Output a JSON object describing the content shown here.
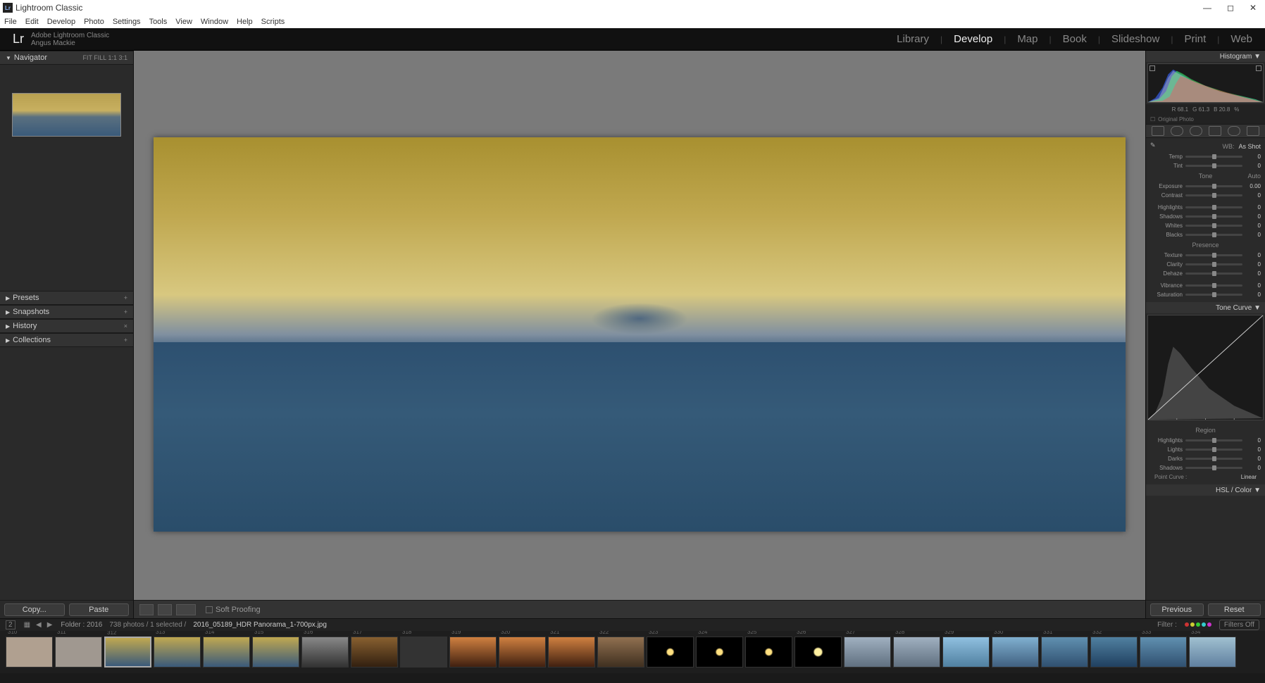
{
  "app_title": "Lightroom Classic",
  "menu": [
    "File",
    "Edit",
    "Develop",
    "Photo",
    "Settings",
    "Tools",
    "View",
    "Window",
    "Help",
    "Scripts"
  ],
  "brand_line1": "Adobe Lightroom Classic",
  "brand_line2": "Angus Mackie",
  "modules": [
    "Library",
    "Develop",
    "Map",
    "Book",
    "Slideshow",
    "Print",
    "Web"
  ],
  "active_module": "Develop",
  "navigator": {
    "label": "Navigator",
    "zoom": "FIT  FILL  1:1  3:1"
  },
  "left_panels": [
    {
      "name": "Presets",
      "extra": "+"
    },
    {
      "name": "Snapshots",
      "extra": "+"
    },
    {
      "name": "History",
      "extra": "×"
    },
    {
      "name": "Collections",
      "extra": "+"
    }
  ],
  "copy_btn": "Copy...",
  "paste_btn": "Paste",
  "soft_proofing": "Soft Proofing",
  "previous_btn": "Previous",
  "reset_btn": "Reset",
  "histogram_label": "Histogram",
  "rgb": {
    "r": "R  68.1",
    "g": "G  61.3",
    "b": "B  20.8",
    "pct": "%"
  },
  "original_photo": "Original Photo",
  "basic": {
    "wb_label": "WB:",
    "wb_value": "As Shot",
    "sliders_top": [
      {
        "label": "Temp",
        "val": "0"
      },
      {
        "label": "Tint",
        "val": "0"
      }
    ],
    "tone_label": "Tone",
    "auto_label": "Auto",
    "sliders_tone": [
      {
        "label": "Exposure",
        "val": "0.00"
      },
      {
        "label": "Contrast",
        "val": "0"
      }
    ],
    "sliders_tone2": [
      {
        "label": "Highlights",
        "val": "0"
      },
      {
        "label": "Shadows",
        "val": "0"
      },
      {
        "label": "Whites",
        "val": "0"
      },
      {
        "label": "Blacks",
        "val": "0"
      }
    ],
    "presence_label": "Presence",
    "sliders_presence": [
      {
        "label": "Texture",
        "val": "0"
      },
      {
        "label": "Clarity",
        "val": "0"
      },
      {
        "label": "Dehaze",
        "val": "0"
      }
    ],
    "sliders_presence2": [
      {
        "label": "Vibrance",
        "val": "0"
      },
      {
        "label": "Saturation",
        "val": "0"
      }
    ]
  },
  "tone_curve_label": "Tone Curve",
  "region": {
    "label": "Region",
    "sliders": [
      {
        "label": "Highlights",
        "val": "0"
      },
      {
        "label": "Lights",
        "val": "0"
      },
      {
        "label": "Darks",
        "val": "0"
      },
      {
        "label": "Shadows",
        "val": "0"
      }
    ],
    "point_curve_label": "Point Curve :",
    "point_curve_val": "Linear"
  },
  "hsl_label": "HSL / Color",
  "filmstrip_hdr": {
    "grid_mode": "2",
    "folder": "Folder : 2016",
    "count": "738 photos / 1 selected /",
    "filename": "2016_05189_HDR Panorama_1-700px.jpg",
    "filter_label": "Filter :",
    "filters_off": "Filters Off"
  },
  "thumbs": [
    {
      "idx": "310",
      "bg": "#b0a090"
    },
    {
      "idx": "311",
      "bg": "#a09890"
    },
    {
      "idx": "312",
      "bg": "linear-gradient(#c0a850,#3a5a7a)",
      "sel": true
    },
    {
      "idx": "313",
      "bg": "linear-gradient(#c0a850,#3a5a7a)"
    },
    {
      "idx": "314",
      "bg": "linear-gradient(#c0a850,#3a5a7a)"
    },
    {
      "idx": "315",
      "bg": "linear-gradient(#c0a850,#3a5a7a)"
    },
    {
      "idx": "316",
      "bg": "linear-gradient(#888,#333)"
    },
    {
      "idx": "317",
      "bg": "linear-gradient(#886030,#332010)"
    },
    {
      "idx": "318",
      "bg": "#333"
    },
    {
      "idx": "319",
      "bg": "linear-gradient(#d08040,#402010)"
    },
    {
      "idx": "320",
      "bg": "linear-gradient(#d08040,#402010)"
    },
    {
      "idx": "321",
      "bg": "linear-gradient(#d08040,#402010)"
    },
    {
      "idx": "322",
      "bg": "linear-gradient(#907050,#403020)"
    },
    {
      "idx": "323",
      "bg": "radial-gradient(circle,#ffe080 4px,#000 6px)"
    },
    {
      "idx": "324",
      "bg": "radial-gradient(circle,#ffe080 4px,#000 6px)"
    },
    {
      "idx": "325",
      "bg": "radial-gradient(circle,#ffe080 4px,#000 6px)"
    },
    {
      "idx": "326",
      "bg": "radial-gradient(circle,#fff0a0 5px,#000 7px)"
    },
    {
      "idx": "327",
      "bg": "linear-gradient(#a0b0c0,#607080)"
    },
    {
      "idx": "328",
      "bg": "linear-gradient(#a0b0c0,#607080)"
    },
    {
      "idx": "329",
      "bg": "linear-gradient(#90c0e0,#5080a0)"
    },
    {
      "idx": "330",
      "bg": "linear-gradient(#80b0d0,#406080)"
    },
    {
      "idx": "331",
      "bg": "linear-gradient(#6090b0,#305070)"
    },
    {
      "idx": "332",
      "bg": "linear-gradient(#5080a0,#204060)"
    },
    {
      "idx": "333",
      "bg": "linear-gradient(#6090b0,#305070)"
    },
    {
      "idx": "334",
      "bg": "linear-gradient(#a0c0d0,#6080a0)"
    }
  ]
}
